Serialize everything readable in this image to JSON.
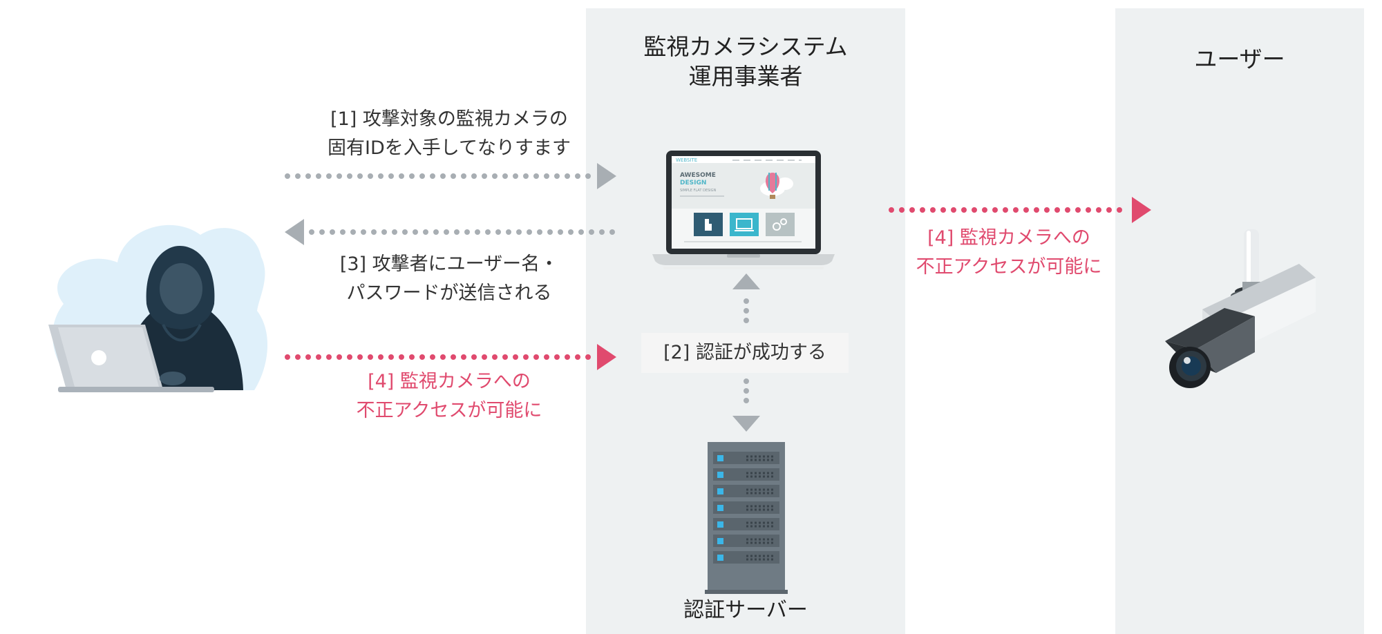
{
  "operator_panel": {
    "title_line1": "監視カメラシステム",
    "title_line2": "運用事業者"
  },
  "user_panel": {
    "title": "ユーザー"
  },
  "steps": {
    "step1_line1": "[1] 攻撃対象の監視カメラの",
    "step1_line2": "固有IDを入手してなりすます",
    "step2": "[2] 認証が成功する",
    "step3_line1": "[3] 攻撃者にユーザー名・",
    "step3_line2": "パスワードが送信される",
    "step4a_line1": "[4] 監視カメラへの",
    "step4a_line2": "不正アクセスが可能に",
    "step4b_line1": "[4] 監視カメラへの",
    "step4b_line2": "不正アクセスが可能に"
  },
  "server": {
    "label": "認証サーバー"
  },
  "website_mock": {
    "brand": "WEBSITE",
    "headline1": "AWESOME",
    "headline2": "DESIGN",
    "tagline": "SIMPLE FLAT DESIGN"
  },
  "colors": {
    "panel": "#eef1f2",
    "arrow_gray": "#a8aeb3",
    "arrow_pink": "#e04a6e",
    "text": "#333333",
    "pink_text": "#e04a6e"
  }
}
